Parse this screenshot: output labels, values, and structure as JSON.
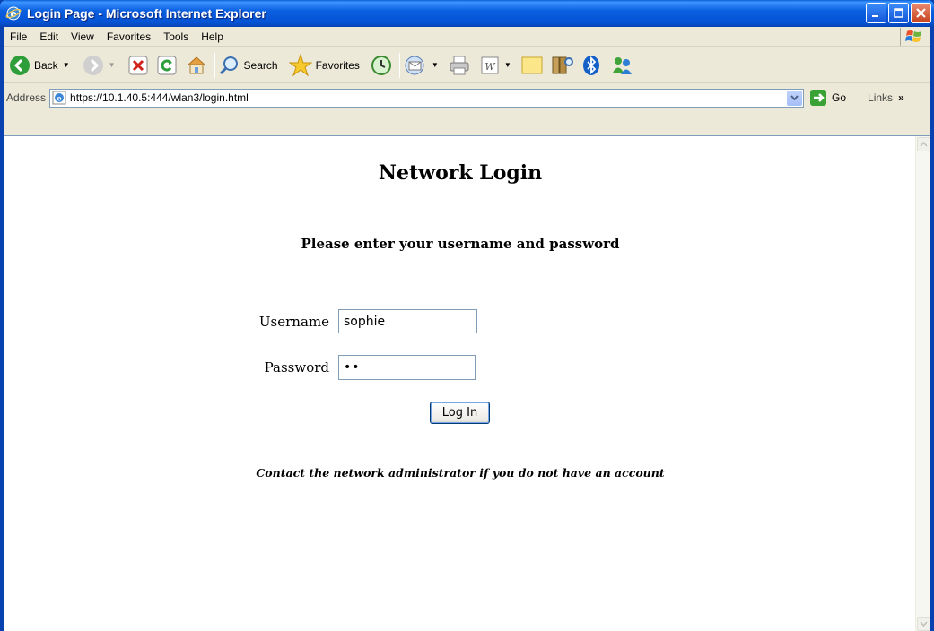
{
  "window": {
    "title": "Login Page - Microsoft Internet Explorer"
  },
  "menu": [
    "File",
    "Edit",
    "View",
    "Favorites",
    "Tools",
    "Help"
  ],
  "toolbar": {
    "back_label": "Back",
    "search_label": "Search",
    "favorites_label": "Favorites"
  },
  "address": {
    "label": "Address",
    "url": "https://10.1.40.5:444/wlan3/login.html",
    "go_label": "Go",
    "links_label": "Links"
  },
  "page": {
    "title": "Network Login",
    "subtitle": "Please enter your username and password",
    "username_label": "Username",
    "username_value": "sophie",
    "password_label": "Password",
    "password_masked": "••",
    "login_button": "Log In",
    "note": "Contact the network administrator if you do not have an account"
  }
}
